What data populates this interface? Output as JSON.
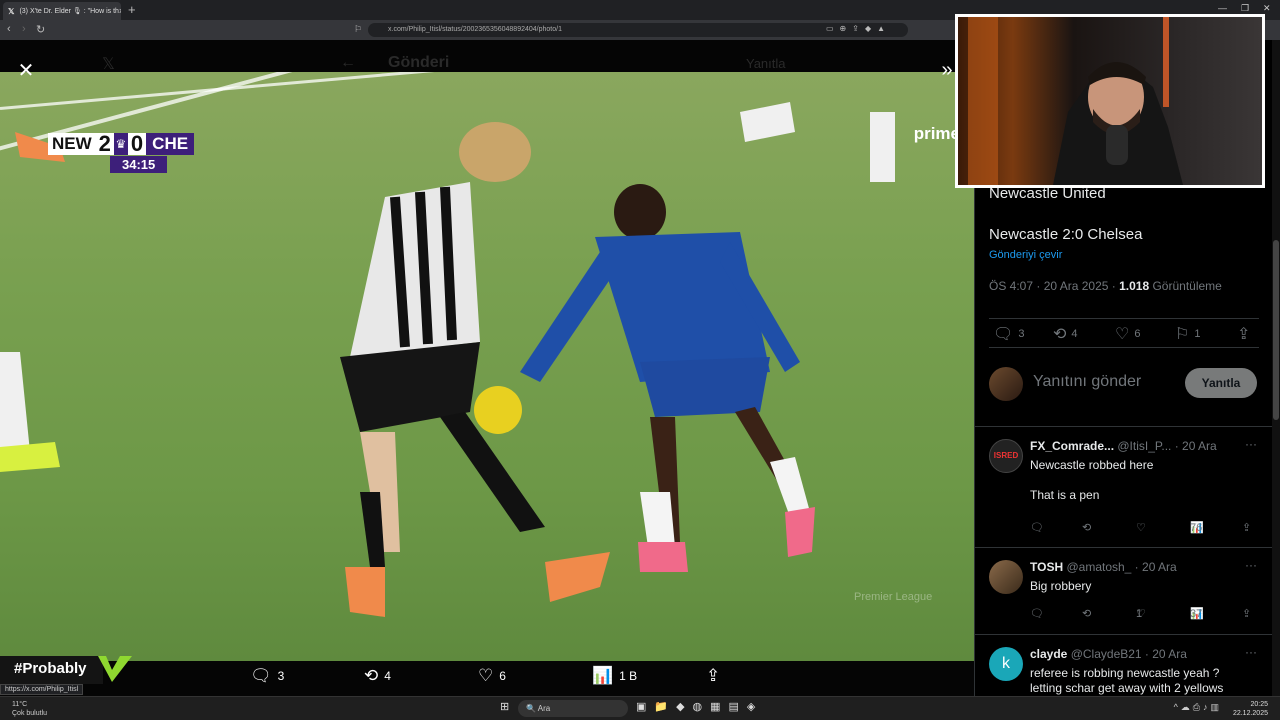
{
  "browser": {
    "tab_title": "(3) X'te Dr. Elder 🎙 : \"How is th",
    "url": "x.com/Philip_Itisl/status/2002365356048892404/photo/1",
    "status_url": "https://x.com/Philip_Itisl"
  },
  "overlay": {
    "header_title": "Gönderi",
    "header_reply": "Yanıtla"
  },
  "scoreboard": {
    "home": "NEW",
    "home_score": "2",
    "away_score": "0",
    "away": "CHE",
    "clock": "34:15",
    "broadcaster": "prime",
    "watermark": "Premier League"
  },
  "media_actions": {
    "replies": "3",
    "reposts": "4",
    "likes": "6",
    "views": "1 B"
  },
  "stream": {
    "tag": "#Probably"
  },
  "post": {
    "author": "Newcastle United",
    "text": "Newcastle 2:0 Chelsea",
    "translate": "Gönderiyi çevir",
    "time": "ÖS 4:07 · 20 Ara 2025 ·",
    "views_count": "1.018",
    "views_label": "Görüntüleme",
    "replies": "3",
    "reposts": "4",
    "likes": "6",
    "bookmarks": "1"
  },
  "compose": {
    "placeholder": "Yanıtını gönder",
    "button": "Yanıtla"
  },
  "replies": [
    {
      "name": "FX_Comrade...",
      "handle": "@ItisI_P... · 20 Ara",
      "body": "Newcastle robbed here\n\nThat is a pen",
      "views": "76"
    },
    {
      "name": "TOSH",
      "handle": "@amatosh_ · 20 Ara",
      "body": "Big robbery",
      "likes": "1",
      "views": "37"
    },
    {
      "name": "clayde",
      "handle": "@ClaydeB21 · 20 Ara",
      "avatar_letter": "k",
      "body": "referee is robbing newcastle yeah ?\nletting schar get away with 2 yellows"
    }
  ],
  "taskbar": {
    "weather_temp": "11°C",
    "weather_desc": "Çok bulutlu",
    "search": "Ara",
    "time": "20:25",
    "date": "22.12.2025"
  },
  "colors": {
    "accent": "#1d9bf0",
    "pitch": "#79a050",
    "chelsea_kit": "#1f4fa8",
    "pl_purple": "#3d1f7a"
  }
}
